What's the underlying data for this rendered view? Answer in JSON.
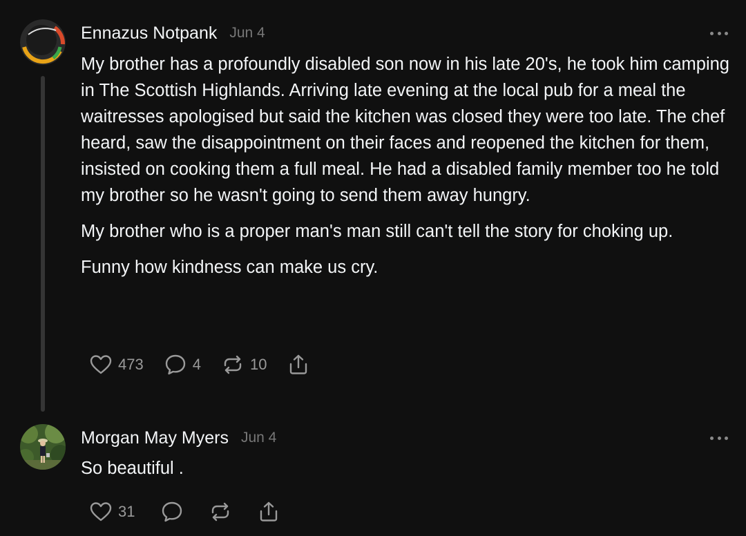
{
  "posts": [
    {
      "author": "Ennazus Notpank",
      "date": "Jun 4",
      "paragraphs": [
        "My brother has a profoundly disabled son now in his late 20's, he took him camping in The Scottish Highlands. Arriving late evening at the local pub for a meal the waitresses apologised but said the kitchen was closed they were too late. The chef heard, saw the disappointment on their faces and reopened the kitchen for them, insisted on cooking them a full meal. He had a disabled family member too he told my brother so he wasn't going to send them away hungry.",
        "My brother who is a proper man's man still can't tell the story for choking up.",
        "Funny how kindness can make us cry."
      ],
      "likes": "473",
      "replies": "4",
      "reposts": "10"
    },
    {
      "author": "Morgan May Myers",
      "date": "Jun 4",
      "paragraphs": [
        "So beautiful ."
      ],
      "likes": "31"
    }
  ],
  "icons": {
    "like": "heart-icon",
    "reply": "comment-icon",
    "repost": "repost-icon",
    "share": "share-icon",
    "more": "more-icon"
  },
  "colors": {
    "background": "#101010",
    "text": "#f3f5f7",
    "secondary": "#777777",
    "icon": "#9a9a9a",
    "thread_line": "#353535"
  }
}
